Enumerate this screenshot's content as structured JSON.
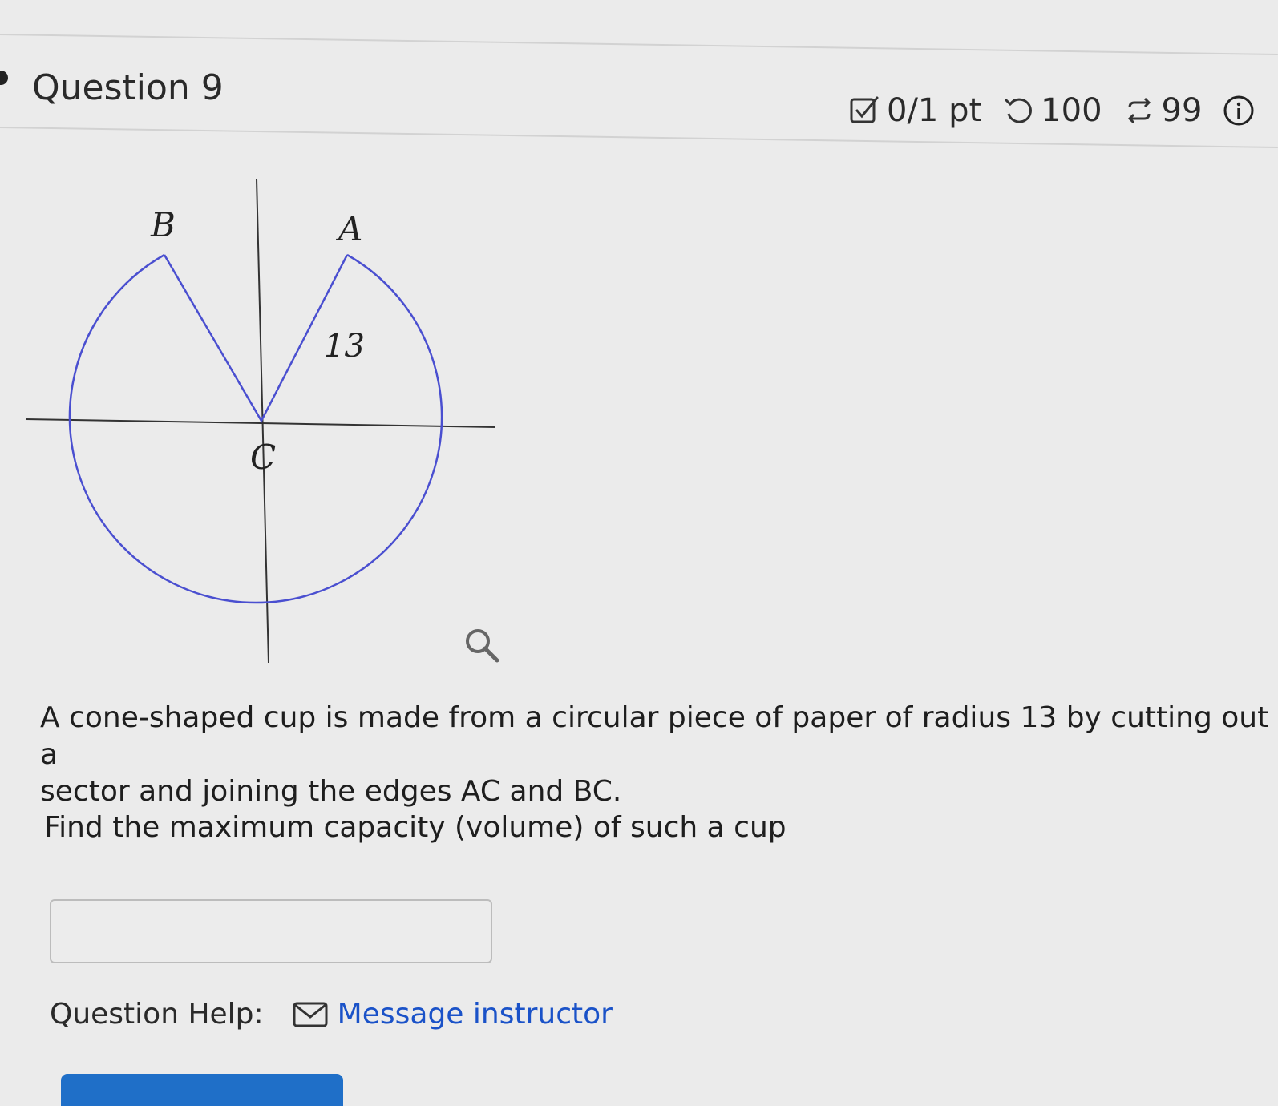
{
  "question": {
    "title": "Question 9",
    "score": "0/1 pt",
    "retries": "100",
    "attempts": "99"
  },
  "diagram": {
    "label_b": "B",
    "label_a": "A",
    "label_c": "C",
    "radius_label": "13",
    "circle_color": "#4a4fd0"
  },
  "text": {
    "paragraph1": "A cone-shaped cup is made from a circular piece of paper of radius 13 by cutting out a\nsector and joining the edges AC and BC.",
    "paragraph2": "Find the maximum capacity (volume) of such a cup"
  },
  "answer": {
    "value": ""
  },
  "help": {
    "label": "Question Help:",
    "link": "Message instructor"
  },
  "icons": {
    "score": "checkbox-pencil-icon",
    "retry": "undo-icon",
    "attempts": "repeat-icon",
    "info": "info-icon",
    "zoom": "magnifier-icon",
    "mail": "envelope-icon"
  }
}
